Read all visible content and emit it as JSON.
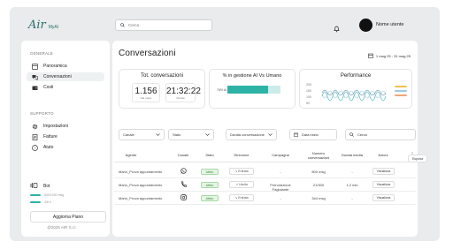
{
  "app": {
    "logo": "Air",
    "logo_suffix": "MyAI",
    "copyright": "@2025 AIR S.r.l."
  },
  "sidebar": {
    "section_general": "GENERALE",
    "section_support": "SUPPORTO",
    "items": [
      {
        "label": "Panoramica",
        "icon": "layout-icon"
      },
      {
        "label": "Conversazioni",
        "icon": "chat-icon"
      },
      {
        "label": "Costi",
        "icon": "wallet-icon"
      },
      {
        "label": "Impostazioni",
        "icon": "gear-icon"
      },
      {
        "label": "Fatture",
        "icon": "invoice-icon"
      },
      {
        "label": "Aiuto",
        "icon": "help-icon"
      }
    ],
    "bot_label": "Bot",
    "usage_lines": [
      "800/1000 msg",
      "4/5 h"
    ],
    "upgrade_label": "Aggiorna Piano"
  },
  "topbar": {
    "search_placeholder": "Cerca",
    "user_name": "Nome utente"
  },
  "main": {
    "title": "Conversazioni",
    "date_range": "1 mag 25 - 31 mag 25"
  },
  "cards": {
    "total_title": "Tot. conversazioni",
    "total_value": "1.156",
    "total_sub": "Nel mese",
    "duration_value": "21:32:22",
    "duration_sub": "Durata",
    "ai_title": "% in gestione AI Vs Umano",
    "ai_label": "76% AI",
    "ai_fraction": 0.76,
    "perf_title": "Performance",
    "perf_ticks": [
      "200",
      "150",
      "100",
      "50"
    ]
  },
  "filters": {
    "canale": "Canale",
    "stato": "Stato",
    "durata": "Durata conversazione",
    "data": "Data inizio",
    "search_placeholder": "Cerca"
  },
  "table": {
    "headers": [
      "Agente",
      "Canale",
      "Stato",
      "Direzione",
      "Campagna",
      "Numero conversazioni",
      "Durata media",
      "Azioni"
    ],
    "rows": [
      {
        "agente": "Mario_Prova appuntamento",
        "canale": "whatsapp-icon",
        "stato": "Attivo",
        "direzione": "Entrata",
        "campagna": "-",
        "numero": "800 msg",
        "durata": "-",
        "azione": "Visualizza"
      },
      {
        "agente": "Mario_Prova appuntamento",
        "canale": "phone-icon",
        "stato": "Attivo",
        "direzione": "Uscita",
        "campagna": "Prenotazione Fagiolante",
        "numero": "21/300",
        "durata": "1.2 min",
        "azione": "Visualizza"
      },
      {
        "agente": "Mario_Prova appuntamento",
        "canale": "instagram-icon",
        "stato": "Attivo",
        "direzione": "Entrata",
        "campagna": "-",
        "numero": "344 msg",
        "durata": "-",
        "azione": "Visualizza"
      }
    ],
    "export_label": "Esporta"
  }
}
